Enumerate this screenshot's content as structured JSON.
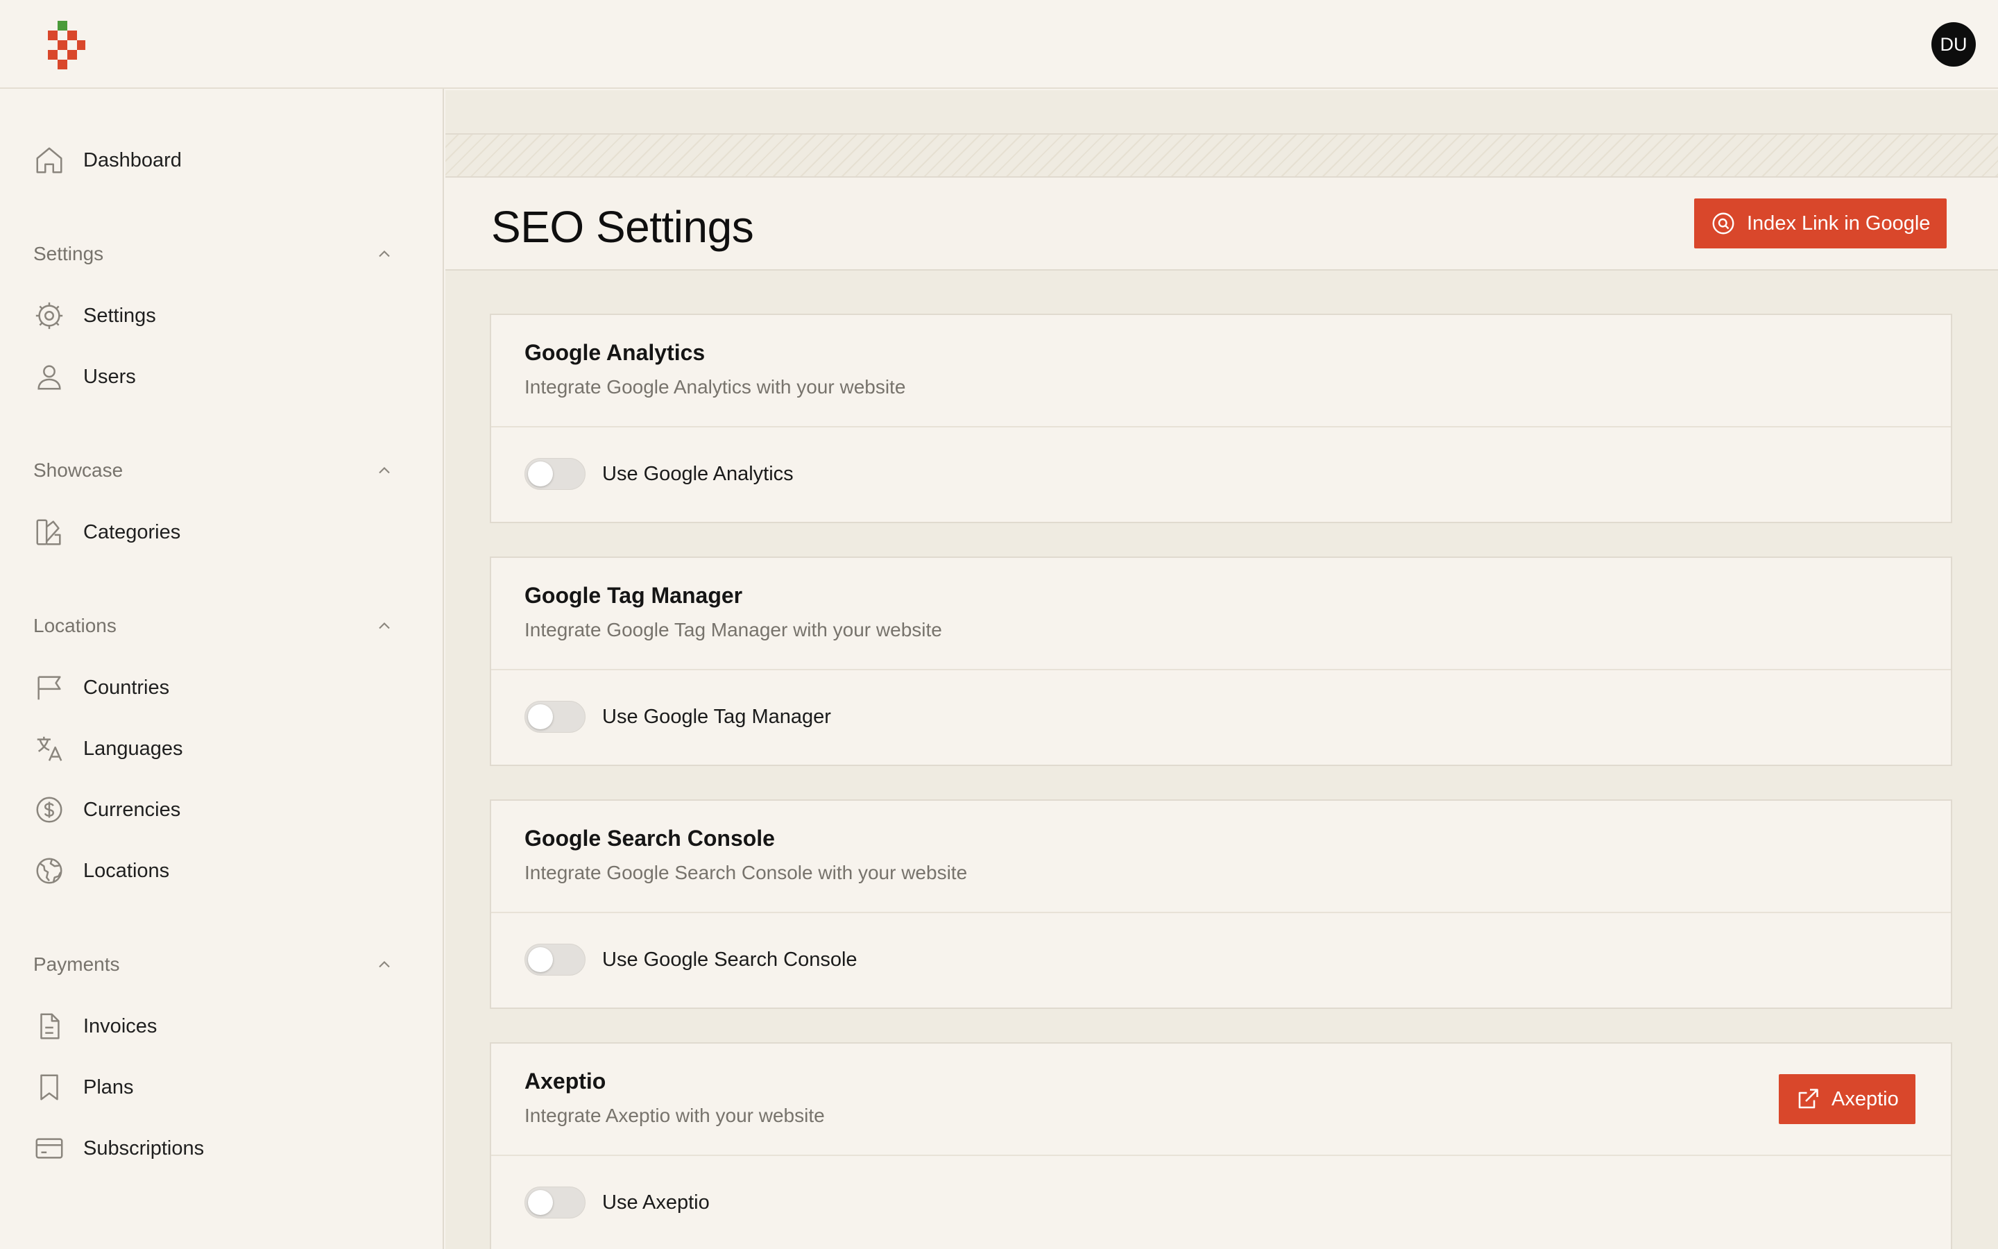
{
  "header": {
    "avatar_initials": "DU",
    "brand_colors": {
      "red": "#d9472b",
      "green": "#4a9b3a"
    }
  },
  "sidebar": {
    "dashboard": {
      "label": "Dashboard",
      "icon": "home-icon"
    },
    "groups": [
      {
        "label": "Settings",
        "items": [
          {
            "label": "Settings",
            "icon": "gear-icon"
          },
          {
            "label": "Users",
            "icon": "user-icon"
          }
        ]
      },
      {
        "label": "Showcase",
        "items": [
          {
            "label": "Categories",
            "icon": "swatch-icon"
          }
        ]
      },
      {
        "label": "Locations",
        "items": [
          {
            "label": "Countries",
            "icon": "flag-icon"
          },
          {
            "label": "Languages",
            "icon": "translate-icon"
          },
          {
            "label": "Currencies",
            "icon": "dollar-circle-icon"
          },
          {
            "label": "Locations",
            "icon": "globe-icon"
          }
        ]
      },
      {
        "label": "Payments",
        "items": [
          {
            "label": "Invoices",
            "icon": "document-icon"
          },
          {
            "label": "Plans",
            "icon": "bookmark-icon"
          },
          {
            "label": "Subscriptions",
            "icon": "credit-card-icon"
          }
        ]
      }
    ]
  },
  "main": {
    "title": "SEO Settings",
    "index_button_label": "Index Link in Google",
    "cards": [
      {
        "title": "Google Analytics",
        "description": "Integrate Google Analytics with your website",
        "toggle_label": "Use Google Analytics",
        "enabled": false
      },
      {
        "title": "Google Tag Manager",
        "description": "Integrate Google Tag Manager with your website",
        "toggle_label": "Use Google Tag Manager",
        "enabled": false
      },
      {
        "title": "Google Search Console",
        "description": "Integrate Google Search Console with your website",
        "toggle_label": "Use Google Search Console",
        "enabled": false
      },
      {
        "title": "Axeptio",
        "description": "Integrate Axeptio with your website",
        "toggle_label": "Use Axeptio",
        "enabled": false,
        "link_button_label": "Axeptio"
      }
    ]
  }
}
